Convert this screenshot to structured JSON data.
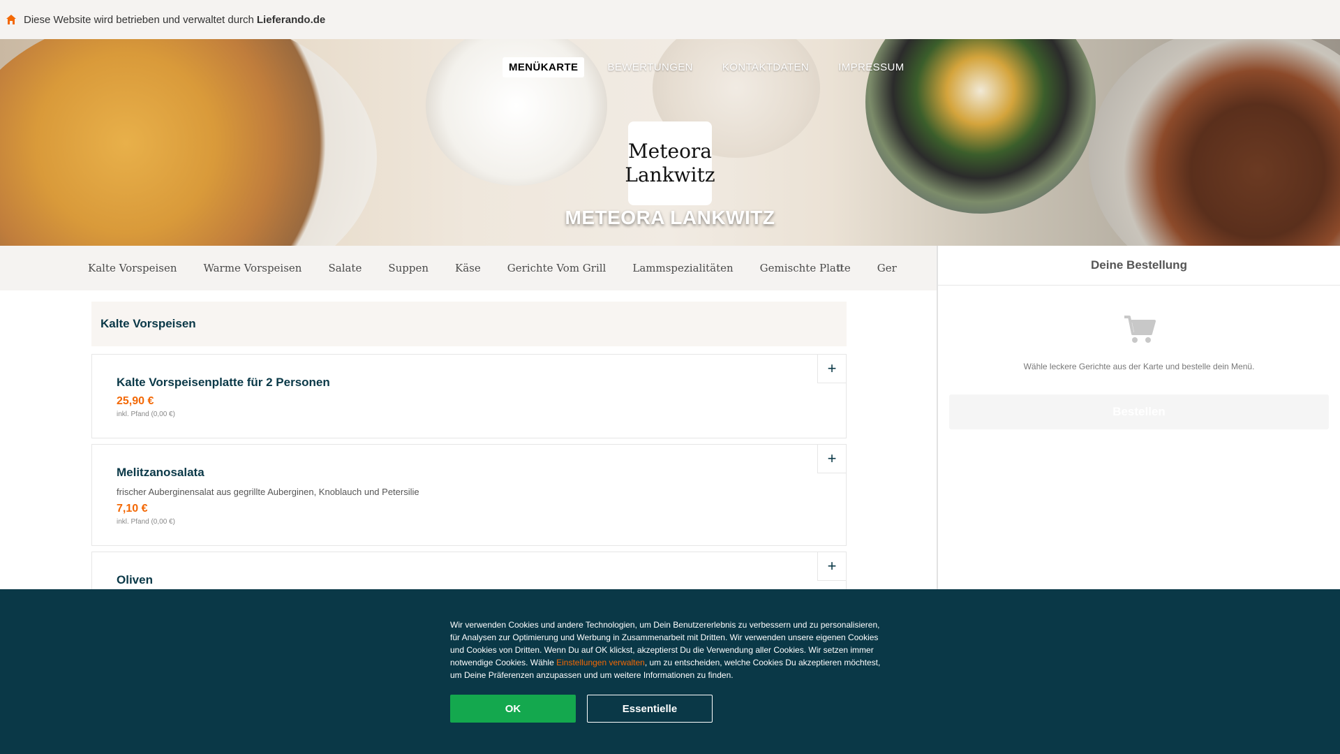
{
  "topbar": {
    "notice": "Diese Website wird betrieben und verwaltet durch",
    "brand": "Lieferando.de"
  },
  "nav": {
    "items": [
      {
        "label": "MENÜKARTE",
        "active": true
      },
      {
        "label": "BEWERTUNGEN"
      },
      {
        "label": "KONTAKTDATEN"
      },
      {
        "label": "IMPRESSUM"
      }
    ]
  },
  "logo": {
    "line1": "Meteora",
    "line2": "Lankwitz"
  },
  "restaurant": {
    "name": "METEORA LANKWITZ"
  },
  "categories": [
    "Kalte Vorspeisen",
    "Warme Vorspeisen",
    "Salate",
    "Suppen",
    "Käse",
    "Gerichte Vom Grill",
    "Lammspezialitäten",
    "Gemischte Platte",
    "Ger"
  ],
  "section": {
    "title": "Kalte Vorspeisen"
  },
  "meals": [
    {
      "name": "Kalte Vorspeisenplatte für 2 Personen",
      "description": "",
      "price": "25,90 €",
      "deposit": "inkl. Pfand (0,00 €)"
    },
    {
      "name": "Melitzanosalata",
      "description": "frischer Auberginensalat aus gegrillte Auberginen, Knoblauch und Petersilie",
      "price": "7,10 €",
      "deposit": "inkl. Pfand (0,00 €)"
    },
    {
      "name": "Oliven",
      "description": "",
      "price": "",
      "deposit": ""
    }
  ],
  "add_label": "+",
  "basket": {
    "title": "Deine Bestellung",
    "hint": "Wähle leckere Gerichte aus der Karte und bestelle dein Menü.",
    "order_label": "Bestellen"
  },
  "cookie": {
    "text_before": "Wir verwenden Cookies und andere Technologien, um Dein Benutzererlebnis zu verbessern und zu personalisieren, für Analysen zur Optimierung und Werbung in Zusammenarbeit mit Dritten. Wir verwenden unsere eigenen Cookies und Cookies von Dritten. Wenn Du auf OK klickst, akzeptierst Du die Verwendung aller Cookies. Wir setzen immer notwendige Cookies. Wähle ",
    "link": "Einstellungen verwalten",
    "text_after": ", um zu entscheiden, welche Cookies Du akzeptieren möchtest, um Deine Präferenzen anzupassen und um weitere Informationen zu finden.",
    "ok_label": "OK",
    "essential_label": "Essentielle"
  },
  "colors": {
    "accent": "#f36805",
    "navy": "#0a3847",
    "ok_green": "#14a84e"
  }
}
